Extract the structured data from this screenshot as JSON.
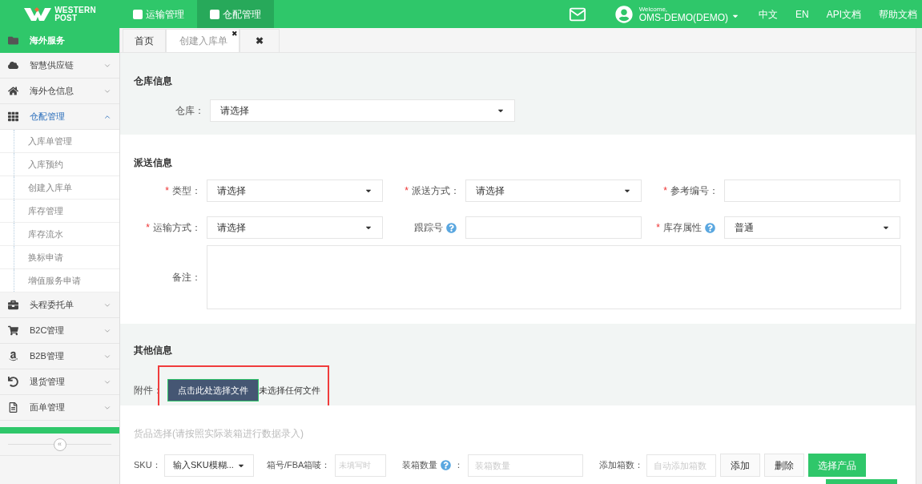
{
  "header": {
    "logo_lines": [
      "WESTERN",
      "POST"
    ],
    "nav": [
      {
        "label": "运输管理",
        "selected": false
      },
      {
        "label": "仓配管理",
        "selected": true
      }
    ],
    "user": {
      "welcome": "Welcome,",
      "name": "OMS-DEMO(DEMO)"
    },
    "links": [
      "中文",
      "EN",
      "API文档",
      "帮助文档"
    ]
  },
  "sidebar": {
    "title": "海外服务",
    "items": [
      {
        "label": "智慧供应链",
        "expanded": false
      },
      {
        "label": "海外仓信息",
        "expanded": false
      },
      {
        "label": "仓配管理",
        "expanded": true,
        "children": [
          {
            "label": "入库单管理"
          },
          {
            "label": "入库预约"
          },
          {
            "label": "创建入库单"
          },
          {
            "label": "库存管理"
          },
          {
            "label": "库存流水"
          },
          {
            "label": "换标申请"
          },
          {
            "label": "增值服务申请"
          }
        ]
      },
      {
        "label": "头程委托单",
        "expanded": false
      },
      {
        "label": "B2C管理",
        "expanded": false
      },
      {
        "label": "B2B管理",
        "expanded": false
      },
      {
        "label": "退货管理",
        "expanded": false
      },
      {
        "label": "面单管理",
        "expanded": false
      }
    ],
    "collapse": "«"
  },
  "tab_close_glyph": "✖",
  "tabs": [
    {
      "kind": "text",
      "label": "首页",
      "selected": false,
      "closable": false
    },
    {
      "kind": "text",
      "label": "创建入库单",
      "selected": true,
      "closable": true
    },
    {
      "kind": "close",
      "selected": false,
      "closable": false
    }
  ],
  "warehouse": {
    "title": "仓库信息",
    "label": "仓库：",
    "value": "请选择"
  },
  "delivery": {
    "title": "派送信息",
    "required_mark": "*",
    "fields": [
      {
        "kind": "select",
        "label": "类型：",
        "required": true,
        "help": false,
        "value": "请选择"
      },
      {
        "kind": "select",
        "label": "派送方式：",
        "required": true,
        "help": false,
        "value": "请选择"
      },
      {
        "kind": "text",
        "label": "参考编号：",
        "required": true,
        "help": false
      },
      {
        "kind": "select",
        "label": "运输方式：",
        "required": true,
        "help": false,
        "value": "请选择"
      },
      {
        "kind": "text",
        "label": "跟踪号",
        "required": false,
        "help": true
      },
      {
        "kind": "select",
        "label": "库存属性",
        "required": true,
        "help": true,
        "value": "普通"
      }
    ],
    "remark": {
      "label": "备注："
    }
  },
  "other": {
    "title": "其他信息",
    "label": "附件：",
    "button": "点击此处选择文件",
    "status": "未选择任何文件",
    "highlighted": true
  },
  "goods": {
    "title": "货品选择(请按照实际装箱进行数据录入)",
    "sku": {
      "label": "SKU：",
      "value": "输入SKU模糊..."
    },
    "box": {
      "label": "箱号/FBA箱唛：",
      "placeholder": "未填写时"
    },
    "qty": {
      "label": "装箱数量",
      "colon": "：",
      "placeholder": "装箱数量"
    },
    "add_count": {
      "label": "添加箱数：",
      "placeholder": "自动添加箱数"
    },
    "buttons": [
      {
        "label": "添加",
        "primary": false
      },
      {
        "label": "删除",
        "primary": false
      },
      {
        "label": "选择产品",
        "primary": true
      }
    ]
  }
}
